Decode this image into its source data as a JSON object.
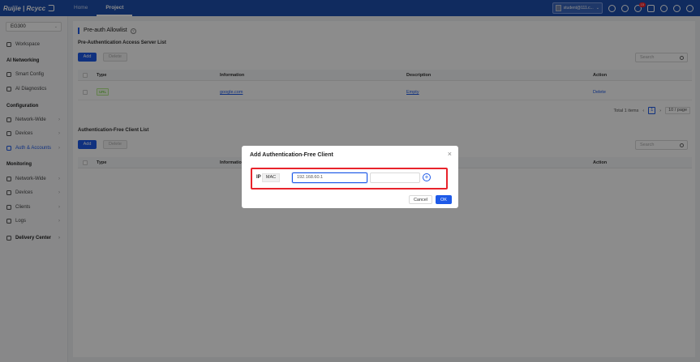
{
  "topbar": {
    "logo": "Ruijie | Rcycc",
    "nav": [
      {
        "label": "Home"
      },
      {
        "label": "Project"
      }
    ],
    "account": "student@111.c...",
    "notification_count": "15",
    "icons": [
      "plus-circle-icon",
      "search-icon",
      "bell-icon",
      "mail-icon",
      "globe-icon",
      "settings-icon",
      "user-icon"
    ]
  },
  "sidebar": {
    "site": "EG300",
    "workspace": "Workspace",
    "groups": [
      {
        "head": "AI Networking",
        "items": [
          "Smart Config",
          "AI Diagnostics"
        ]
      },
      {
        "head": "Configuration",
        "items": [
          "Network-Wide",
          "Devices",
          "Auth & Accounts"
        ]
      },
      {
        "head": "Monitoring",
        "items": [
          "Network-Wide",
          "Devices",
          "Clients",
          "Logs"
        ]
      }
    ],
    "delivery": "Delivery Center"
  },
  "main": {
    "title": "Pre-auth Allowlist",
    "section1": {
      "title": "Pre-Authentication Access Server List",
      "add": "Add",
      "delete": "Delete",
      "search_placeholder": "Search",
      "columns": [
        "Type",
        "Information",
        "Description",
        "Action"
      ],
      "rows": [
        {
          "type": "URL",
          "info": "google.com",
          "desc": "Empty",
          "action": "Delete"
        }
      ],
      "pager": {
        "total": "Total 1 items",
        "page": "1",
        "size": "10 / page"
      }
    },
    "section2": {
      "title": "Authentication-Free Client List",
      "add": "Add",
      "delete": "Delete",
      "search_placeholder": "Search",
      "columns": [
        "Type",
        "Information",
        "Action"
      ]
    }
  },
  "modal": {
    "title": "Add Authentication-Free Client",
    "ip_label": "IP",
    "mac_label": "MAC",
    "ip_value": "192.168.60.1",
    "cancel": "Cancel",
    "ok": "OK"
  }
}
